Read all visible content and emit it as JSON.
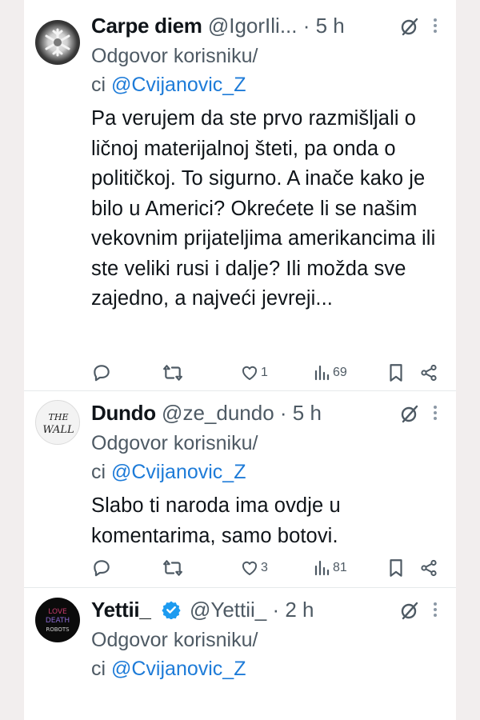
{
  "tweets": [
    {
      "name": "Carpe diem",
      "handle": "@IgorIli...",
      "time": "5 h",
      "reply_prefix": "Odgovor korisniku/",
      "reply_line2_prefix": "ci ",
      "mention": "@Cvijanovic_Z",
      "body": "Pa verujem da ste prvo razmišljali o ličnoj materijalnoj šteti, pa onda o političkoj. To sigurno. A inače kako je bilo u Americi? Okrećete li se našim vekovnim prijateljima amerikancima ili ste veliki rusi i dalje? Ili možda sve zajedno, a najveći jevreji...",
      "likes": "1",
      "views": "69"
    },
    {
      "name": "Dundo",
      "handle": "@ze_dundo",
      "time": "5 h",
      "reply_prefix": "Odgovor korisniku/",
      "reply_line2_prefix": "ci ",
      "mention": "@Cvijanovic_Z",
      "body": "Slabo ti naroda ima ovdje u komentarima, samo botovi.",
      "likes": "3",
      "views": "81"
    },
    {
      "name": "Yettii_",
      "handle": "@Yettii_",
      "time": "2 h",
      "reply_prefix": "Odgovor korisniku/",
      "reply_line2_prefix": "ci ",
      "mention": "@Cvijanovic_Z"
    }
  ],
  "avatars": {
    "t2_lines": [
      "THE",
      "WALL"
    ],
    "t3_lines": [
      "LOVE",
      "DEATH",
      "ROBOTS"
    ]
  },
  "colors": {
    "link": "#1d7bd8",
    "muted": "#4e5a64",
    "verified": "#1d9bf0"
  },
  "icons": [
    "reply-icon",
    "retweet-icon",
    "like-icon",
    "views-icon",
    "bookmark-icon",
    "share-icon",
    "grok-icon",
    "more-icon",
    "verified-icon"
  ]
}
